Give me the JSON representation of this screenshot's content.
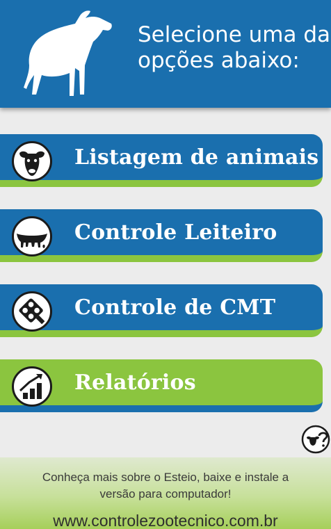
{
  "header": {
    "line1": "Selecione uma das",
    "line2": "opções abaixo:",
    "logo_icon": "cow-silhouette-icon"
  },
  "menu": [
    {
      "label": "Listagem de animais",
      "icon": "cow-head-icon",
      "color": "#1a6fae"
    },
    {
      "label": "Controle Leiteiro",
      "icon": "udder-icon",
      "color": "#1a6fae"
    },
    {
      "label": "Controle de CMT",
      "icon": "cmt-paddle-icon",
      "color": "#1a6fae"
    },
    {
      "label": "Relatórios",
      "icon": "bar-chart-trend-icon",
      "color": "#8bc53f"
    }
  ],
  "help": {
    "icon": "help-cow-icon"
  },
  "footer": {
    "line1": "Conheça mais sobre o Esteio, baixe e instale a",
    "line2": "versão para computador!",
    "link": "www.controlezootecnico.com.br"
  },
  "colors": {
    "primary": "#1a6fae",
    "accent": "#8bc53f",
    "background": "#ececec"
  }
}
